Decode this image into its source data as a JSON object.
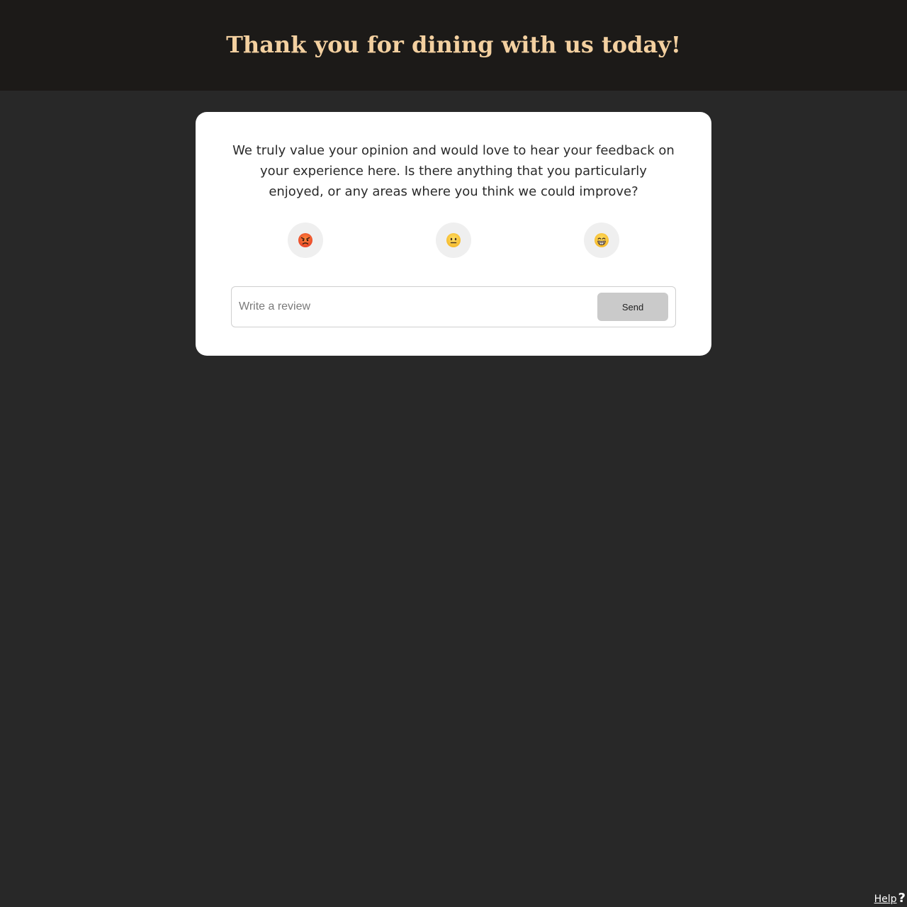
{
  "header": {
    "title": "Thank you for dining with us today!"
  },
  "feedback": {
    "prompt": "We truly value your opinion and would love to hear your feedback on your experience here. Is there anything that you particularly enjoyed, or any areas where you think we could improve?",
    "moods": [
      {
        "icon": "angry-face-icon"
      },
      {
        "icon": "neutral-face-icon"
      },
      {
        "icon": "grinning-face-icon"
      }
    ],
    "review_placeholder": "Write a review",
    "send_label": "Send"
  },
  "footer": {
    "help_label": "Help",
    "help_icon": "?"
  },
  "colors": {
    "header_bg": "#1c1a18",
    "page_bg": "#282828",
    "title": "#f3d0a0",
    "card_bg": "#ffffff",
    "send_bg": "#cacaca"
  }
}
